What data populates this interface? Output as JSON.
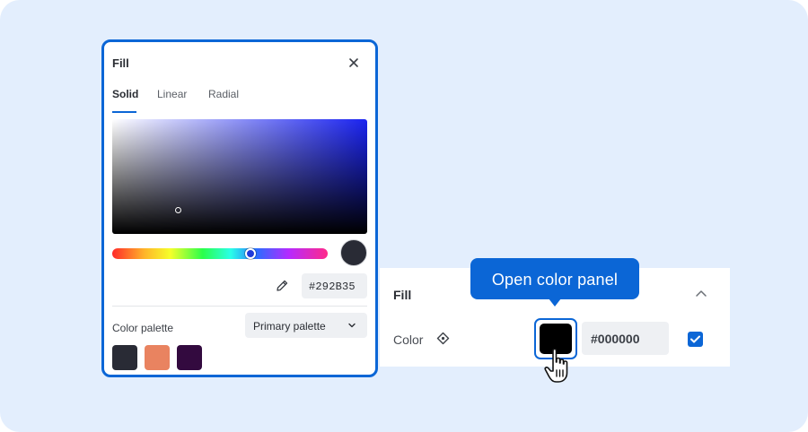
{
  "fill_panel": {
    "title": "Fill",
    "tabs": [
      {
        "label": "Solid",
        "active": true
      },
      {
        "label": "Linear",
        "active": false
      },
      {
        "label": "Radial",
        "active": false
      }
    ],
    "hex_value": "#292B35",
    "preview_color": "#292b35",
    "palette_label": "Color palette",
    "palette_selected": "Primary palette",
    "swatches": [
      "#292b35",
      "#e98360",
      "#330a3f"
    ]
  },
  "props": {
    "title": "Fill",
    "color_label": "Color",
    "hex_value": "#000000",
    "current_color": "#000000",
    "visible_checked": true
  },
  "tooltip": {
    "text": "Open color panel"
  },
  "colors": {
    "accent": "#0b66d6",
    "background": "#e3eefd"
  },
  "icons": [
    "close-icon",
    "eyedropper-icon",
    "chevron-down-icon",
    "chevron-up-icon",
    "variable-icon",
    "check-icon",
    "hand-cursor-icon"
  ]
}
